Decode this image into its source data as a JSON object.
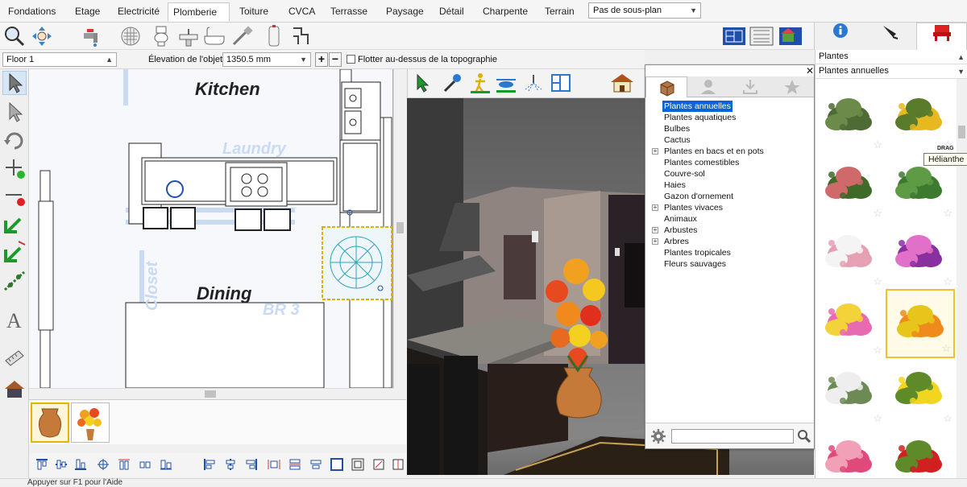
{
  "menu": {
    "tabs": [
      "Fondations",
      "Etage",
      "Electricité",
      "Plomberie",
      "Toiture",
      "CVCA",
      "Terrasse",
      "Paysage",
      "Détail",
      "Charpente",
      "Terrain"
    ],
    "active": "Plomberie",
    "plan_select": "Pas de sous-plan"
  },
  "toolbar": {
    "icons": [
      "zoom-icon",
      "pan-icon",
      "faucet-icon",
      "drain-grid-icon",
      "toilet-icon",
      "sink-icon",
      "bathtub-icon",
      "shower-icon",
      "water-heater-icon",
      "pipe-icon"
    ],
    "right_icons": [
      "floor-plan-view-icon",
      "elevation-view-icon",
      "3d-view-icon"
    ]
  },
  "right_tabs": [
    "info-icon",
    "pen-icon",
    "chair-icon"
  ],
  "floorbar": {
    "floor_value": "Floor 1",
    "elevation_label": "Élevation de l'objet:",
    "elevation_value": "1350.5 mm",
    "float_label": "Flotter au-dessus de la topographie"
  },
  "plan": {
    "rooms": {
      "kitchen": "Kitchen",
      "dining": "Dining",
      "laundry": "Laundry",
      "closet": "Closet",
      "br3": "BR 3"
    }
  },
  "thumbnails": [
    "vase-thumbnail",
    "flowers-thumbnail"
  ],
  "status": "Appuyer sur F1 pour l'Aide",
  "library": {
    "tabs": [
      "catalog-box-icon",
      "user-icon",
      "download-icon",
      "favorites-star-icon"
    ],
    "tree": [
      {
        "label": "Plantes annuelles",
        "expandable": false,
        "selected": true
      },
      {
        "label": "Plantes aquatiques",
        "expandable": false
      },
      {
        "label": "Bulbes",
        "expandable": false
      },
      {
        "label": "Cactus",
        "expandable": false
      },
      {
        "label": "Plantes en bacs et en pots",
        "expandable": true
      },
      {
        "label": "Plantes comestibles",
        "expandable": false
      },
      {
        "label": "Couvre-sol",
        "expandable": false
      },
      {
        "label": "Haies",
        "expandable": false
      },
      {
        "label": "Gazon d'ornement",
        "expandable": false
      },
      {
        "label": "Plantes vivaces",
        "expandable": true
      },
      {
        "label": "Animaux",
        "expandable": false
      },
      {
        "label": "Arbustes",
        "expandable": true
      },
      {
        "label": "Arbres",
        "expandable": true
      },
      {
        "label": "Plantes tropicales",
        "expandable": false
      },
      {
        "label": "Fleurs sauvages",
        "expandable": false
      }
    ],
    "search_placeholder": ""
  },
  "catalog": {
    "category": "Plantes",
    "subcategory": "Plantes annuelles",
    "tooltip": "Hélianthe",
    "drag_label": "DRAG",
    "items": [
      {
        "name": "green-shrub",
        "color": "#4e6b36",
        "accent": "#6c8a4a"
      },
      {
        "name": "sunflower",
        "color": "#e8b820",
        "accent": "#5a7a2c"
      },
      {
        "name": "flowering-bush",
        "color": "#3f6a2a",
        "accent": "#d06a6a"
      },
      {
        "name": "fern-bush",
        "color": "#3d7a30",
        "accent": "#5f9a45"
      },
      {
        "name": "pink-white-flowers",
        "color": "#e6a0b4",
        "accent": "#f4f4f4"
      },
      {
        "name": "purple-petunias",
        "color": "#8a2fa0",
        "accent": "#e070c8"
      },
      {
        "name": "mixed-bouquet",
        "color": "#e86ab0",
        "accent": "#f3d23a"
      },
      {
        "name": "orange-bouquet",
        "color": "#f08a1c",
        "accent": "#e8c51a"
      },
      {
        "name": "white-flowering-shrub",
        "color": "#6d8a55",
        "accent": "#eeeeee"
      },
      {
        "name": "yellow-flowers",
        "color": "#f1d51e",
        "accent": "#5e8a2a"
      },
      {
        "name": "pink-flowers",
        "color": "#e04a7a",
        "accent": "#f2a0b8"
      },
      {
        "name": "red-flowers",
        "color": "#d02020",
        "accent": "#5e8a2a"
      }
    ]
  }
}
